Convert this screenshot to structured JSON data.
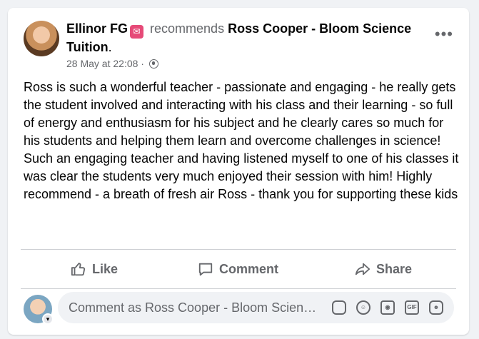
{
  "post": {
    "author": "Ellinor FG",
    "verb": "recommends",
    "page_name": "Ross Cooper - Bloom Science Tuition",
    "page_suffix": ".",
    "timestamp": "28 May at 22:08",
    "separator": "·",
    "more_icon": "more-options-icon",
    "paragraphs": [
      "Ross is such a wonderful teacher - passionate and engaging - he really gets the student involved and interacting with his class and their learning - so full of energy and enthusiasm for his subject and he clearly cares so much for his students and helping them learn and overcome challenges in science!",
      "Such an engaging teacher and having listened myself to one of his classes it was clear the students very much enjoyed their session with him! Highly recommend - a breath of fresh air Ross - thank you for supporting these kids"
    ]
  },
  "actions": {
    "like": "Like",
    "comment": "Comment",
    "share": "Share"
  },
  "comment_box": {
    "placeholder": "Comment as Ross Cooper - Bloom Science Tuition",
    "gif_label": "GIF"
  }
}
